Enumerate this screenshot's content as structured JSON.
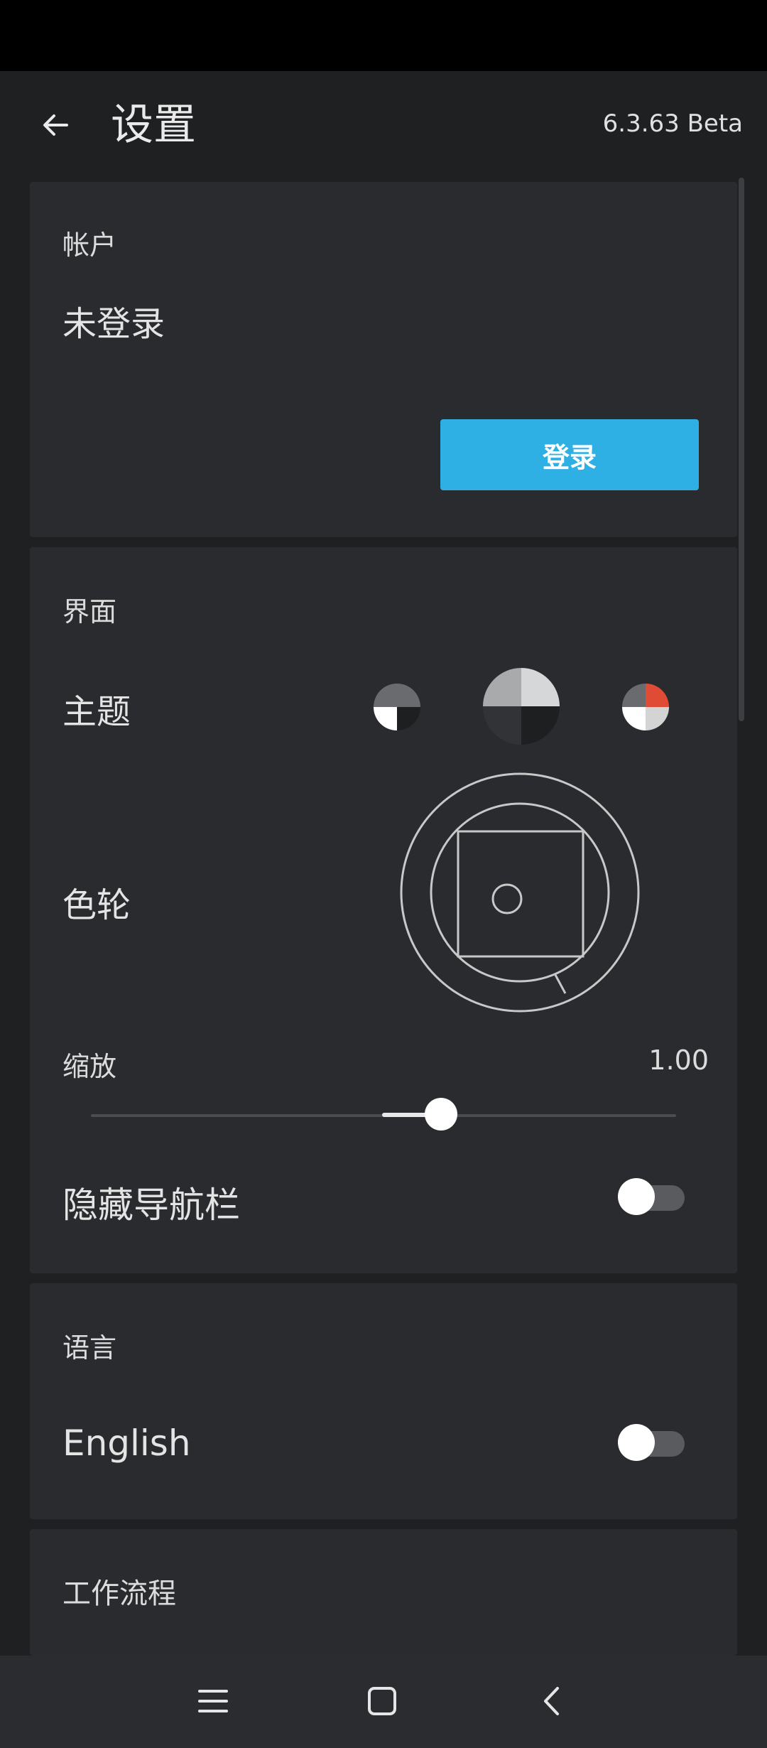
{
  "header": {
    "title": "设置",
    "version": "6.3.63 Beta"
  },
  "account": {
    "section_label": "帐户",
    "status": "未登录",
    "login_label": "登录"
  },
  "interface": {
    "section_label": "界面",
    "theme_label": "主题",
    "themes": [
      "theme-gray",
      "theme-large-selected",
      "theme-red"
    ],
    "color_wheel_label": "色轮",
    "zoom_label": "缩放",
    "zoom_value": "1.00",
    "zoom_fraction": 0.6,
    "hide_nav_label": "隐藏导航栏",
    "hide_nav_enabled": false
  },
  "language": {
    "section_label": "语言",
    "english_label": "English",
    "english_enabled": false
  },
  "workflow": {
    "section_label": "工作流程"
  },
  "navbar": {
    "icons": [
      "menu-icon",
      "home-icon",
      "back-icon"
    ]
  },
  "colors": {
    "accent": "#2eb0e4",
    "background": "#1f2022",
    "card": "#2a2b2e",
    "red": "#e04b35"
  }
}
